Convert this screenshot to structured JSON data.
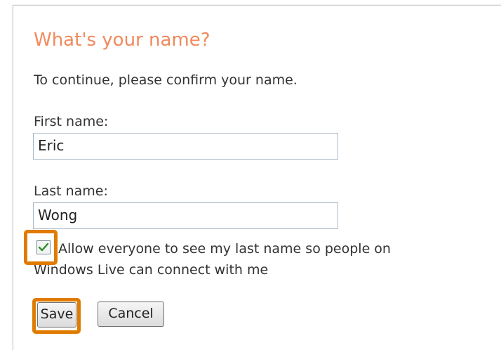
{
  "dialog": {
    "title": "What's your name?",
    "subtitle": "To continue, please confirm your name."
  },
  "form": {
    "first_name_label": "First name:",
    "first_name_value": "Eric",
    "last_name_label": "Last name:",
    "last_name_value": "Wong",
    "allow_checkbox_checked": true,
    "allow_text_line1": "Allow everyone to see my last name so people on",
    "allow_text_line2": "Windows Live can connect with me"
  },
  "buttons": {
    "save_label": "Save",
    "cancel_label": "Cancel"
  },
  "colors": {
    "title": "#f08a5d",
    "highlight": "#e07b00",
    "checkmark": "#2e8b2e"
  },
  "icons": {
    "checkbox": "checkmark-icon"
  }
}
